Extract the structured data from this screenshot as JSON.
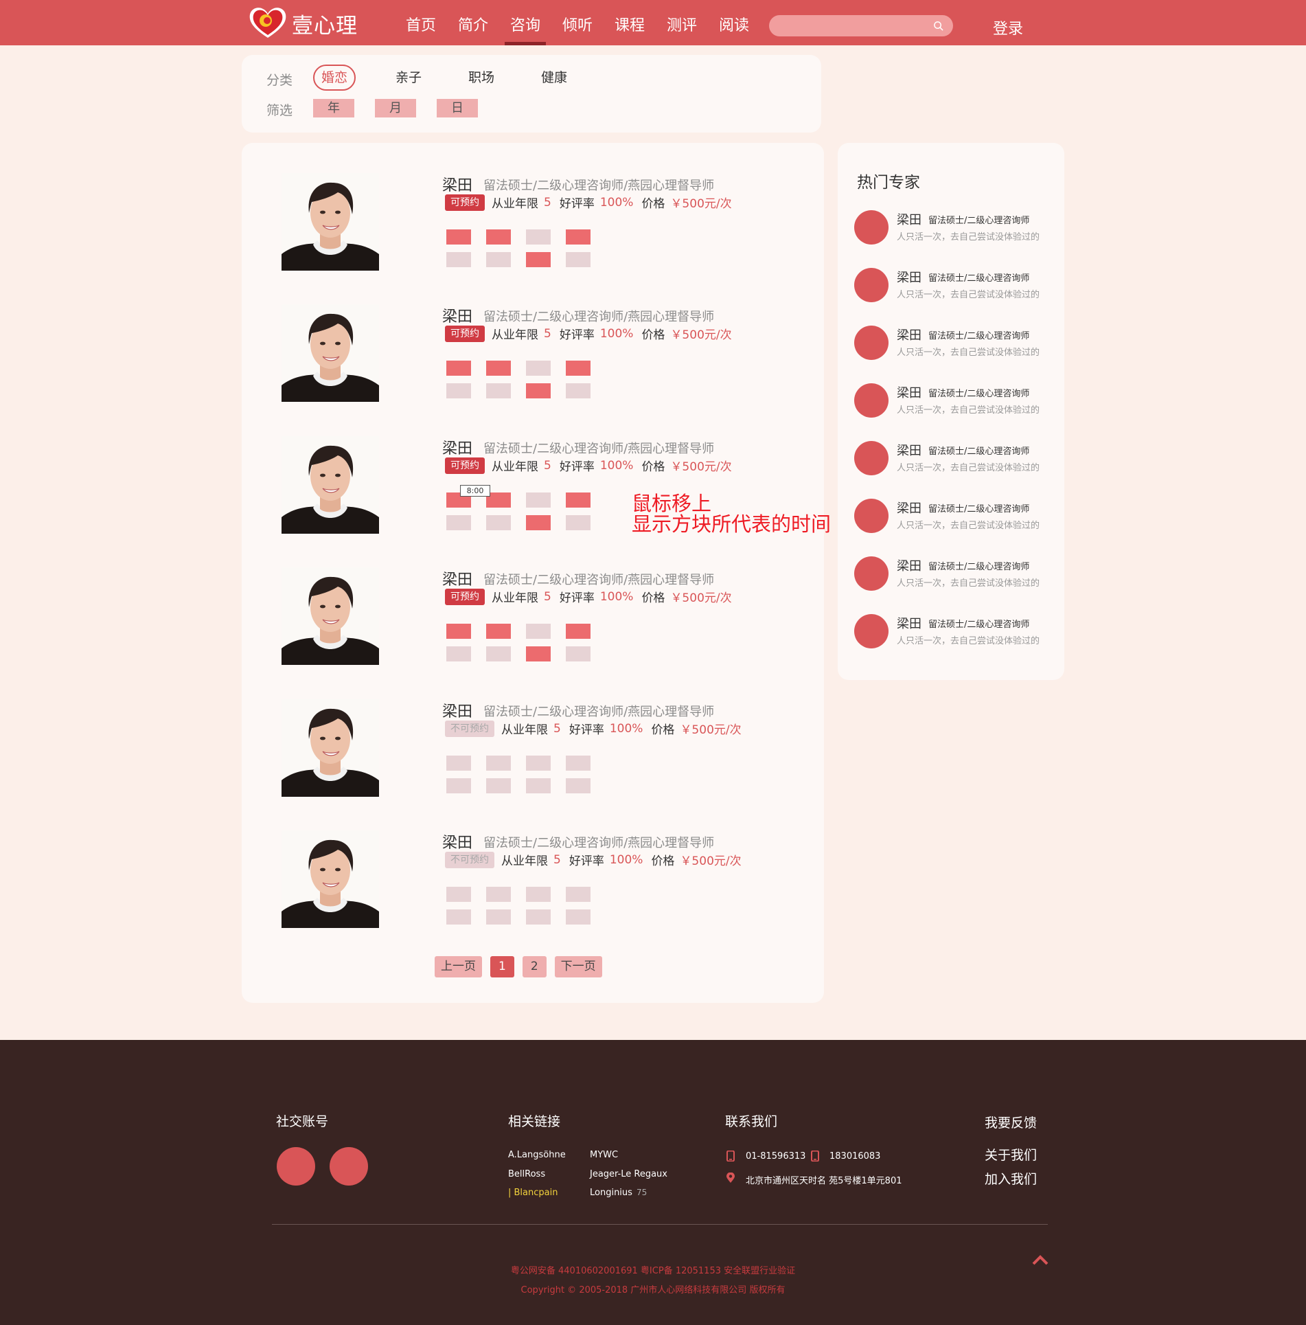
{
  "header": {
    "brand": "壹心理",
    "nav": [
      "首页",
      "简介",
      "咨询",
      "倾听",
      "课程",
      "测评",
      "阅读"
    ],
    "active_nav": "咨询",
    "search_placeholder": "",
    "login": "登录"
  },
  "filter": {
    "category_label": "分类",
    "categories": [
      "婚恋",
      "亲子",
      "职场",
      "健康"
    ],
    "active_category": "婚恋",
    "filter_label": "筛选",
    "dates": [
      "年",
      "月",
      "日"
    ]
  },
  "counselors": [
    {
      "name": "梁田",
      "title": "留法硕士/二级心理咨询师/燕园心理督导师",
      "status": "可预约",
      "available": true,
      "years_label": "从业年限",
      "years": "5",
      "rating_label": "好评率",
      "rating": "100%",
      "price_label": "价格",
      "price": "￥500元/次",
      "slots": [
        1,
        1,
        0,
        1,
        0,
        0,
        1,
        0
      ]
    },
    {
      "name": "梁田",
      "title": "留法硕士/二级心理咨询师/燕园心理督导师",
      "status": "可预约",
      "available": true,
      "years_label": "从业年限",
      "years": "5",
      "rating_label": "好评率",
      "rating": "100%",
      "price_label": "价格",
      "price": "￥500元/次",
      "slots": [
        1,
        1,
        0,
        1,
        0,
        0,
        1,
        0
      ]
    },
    {
      "name": "梁田",
      "title": "留法硕士/二级心理咨询师/燕园心理督导师",
      "status": "可预约",
      "available": true,
      "years_label": "从业年限",
      "years": "5",
      "rating_label": "好评率",
      "rating": "100%",
      "price_label": "价格",
      "price": "￥500元/次",
      "slots": [
        1,
        1,
        0,
        1,
        0,
        0,
        1,
        0
      ],
      "tooltip": "8:00"
    },
    {
      "name": "梁田",
      "title": "留法硕士/二级心理咨询师/燕园心理督导师",
      "status": "可预约",
      "available": true,
      "years_label": "从业年限",
      "years": "5",
      "rating_label": "好评率",
      "rating": "100%",
      "price_label": "价格",
      "price": "￥500元/次",
      "slots": [
        1,
        1,
        0,
        1,
        0,
        0,
        1,
        0
      ]
    },
    {
      "name": "梁田",
      "title": "留法硕士/二级心理咨询师/燕园心理督导师",
      "status": "不可预约",
      "available": false,
      "years_label": "从业年限",
      "years": "5",
      "rating_label": "好评率",
      "rating": "100%",
      "price_label": "价格",
      "price": "￥500元/次",
      "slots": [
        0,
        0,
        0,
        0,
        0,
        0,
        0,
        0
      ]
    },
    {
      "name": "梁田",
      "title": "留法硕士/二级心理咨询师/燕园心理督导师",
      "status": "不可预约",
      "available": false,
      "years_label": "从业年限",
      "years": "5",
      "rating_label": "好评率",
      "rating": "100%",
      "price_label": "价格",
      "price": "￥500元/次",
      "slots": [
        0,
        0,
        0,
        0,
        0,
        0,
        0,
        0
      ]
    }
  ],
  "annotation": {
    "line1": "鼠标移上",
    "line2": "显示方块所代表的时间"
  },
  "pagination": {
    "prev": "上一页",
    "pages": [
      "1",
      "2"
    ],
    "current": "1",
    "next": "下一页"
  },
  "sidebar": {
    "title": "热门专家",
    "experts": [
      {
        "name": "梁田",
        "title": "留法硕士/二级心理咨询师",
        "desc": "人只活一次，去自己尝试没体验过的"
      },
      {
        "name": "梁田",
        "title": "留法硕士/二级心理咨询师",
        "desc": "人只活一次，去自己尝试没体验过的"
      },
      {
        "name": "梁田",
        "title": "留法硕士/二级心理咨询师",
        "desc": "人只活一次，去自己尝试没体验过的"
      },
      {
        "name": "梁田",
        "title": "留法硕士/二级心理咨询师",
        "desc": "人只活一次，去自己尝试没体验过的"
      },
      {
        "name": "梁田",
        "title": "留法硕士/二级心理咨询师",
        "desc": "人只活一次，去自己尝试没体验过的"
      },
      {
        "name": "梁田",
        "title": "留法硕士/二级心理咨询师",
        "desc": "人只活一次，去自己尝试没体验过的"
      },
      {
        "name": "梁田",
        "title": "留法硕士/二级心理咨询师",
        "desc": "人只活一次，去自己尝试没体验过的"
      },
      {
        "name": "梁田",
        "title": "留法硕士/二级心理咨询师",
        "desc": "人只活一次，去自己尝试没体验过的"
      }
    ]
  },
  "footer": {
    "social_heading": "社交账号",
    "links_heading": "相关链接",
    "links_col1": [
      "A.Langsöhne",
      "BellRoss",
      "Blancpain"
    ],
    "links_col2": [
      "MYWC",
      "Jeager-Le Regaux",
      "Longinius"
    ],
    "longinius_count": "75",
    "contact_heading": "联系我们",
    "phone1": "01-81596313",
    "phone2": "183016083",
    "address": "北京市通州区天时名  苑5号楼1单元801",
    "feedback": "我要反馈",
    "about": "关于我们",
    "join": "加入我们",
    "legal1": "粤公网安备 44010602001691  粤ICP备 12051153  安全联盟行业验证",
    "legal2": "Copyright © 2005-2018 广州市人心网络科技有限公司 版权所有"
  },
  "colors": {
    "brand_red": "#d95557",
    "slot_on": "#ec6b6e",
    "slot_off": "#e7d3d5",
    "footer_bg": "#392422"
  }
}
